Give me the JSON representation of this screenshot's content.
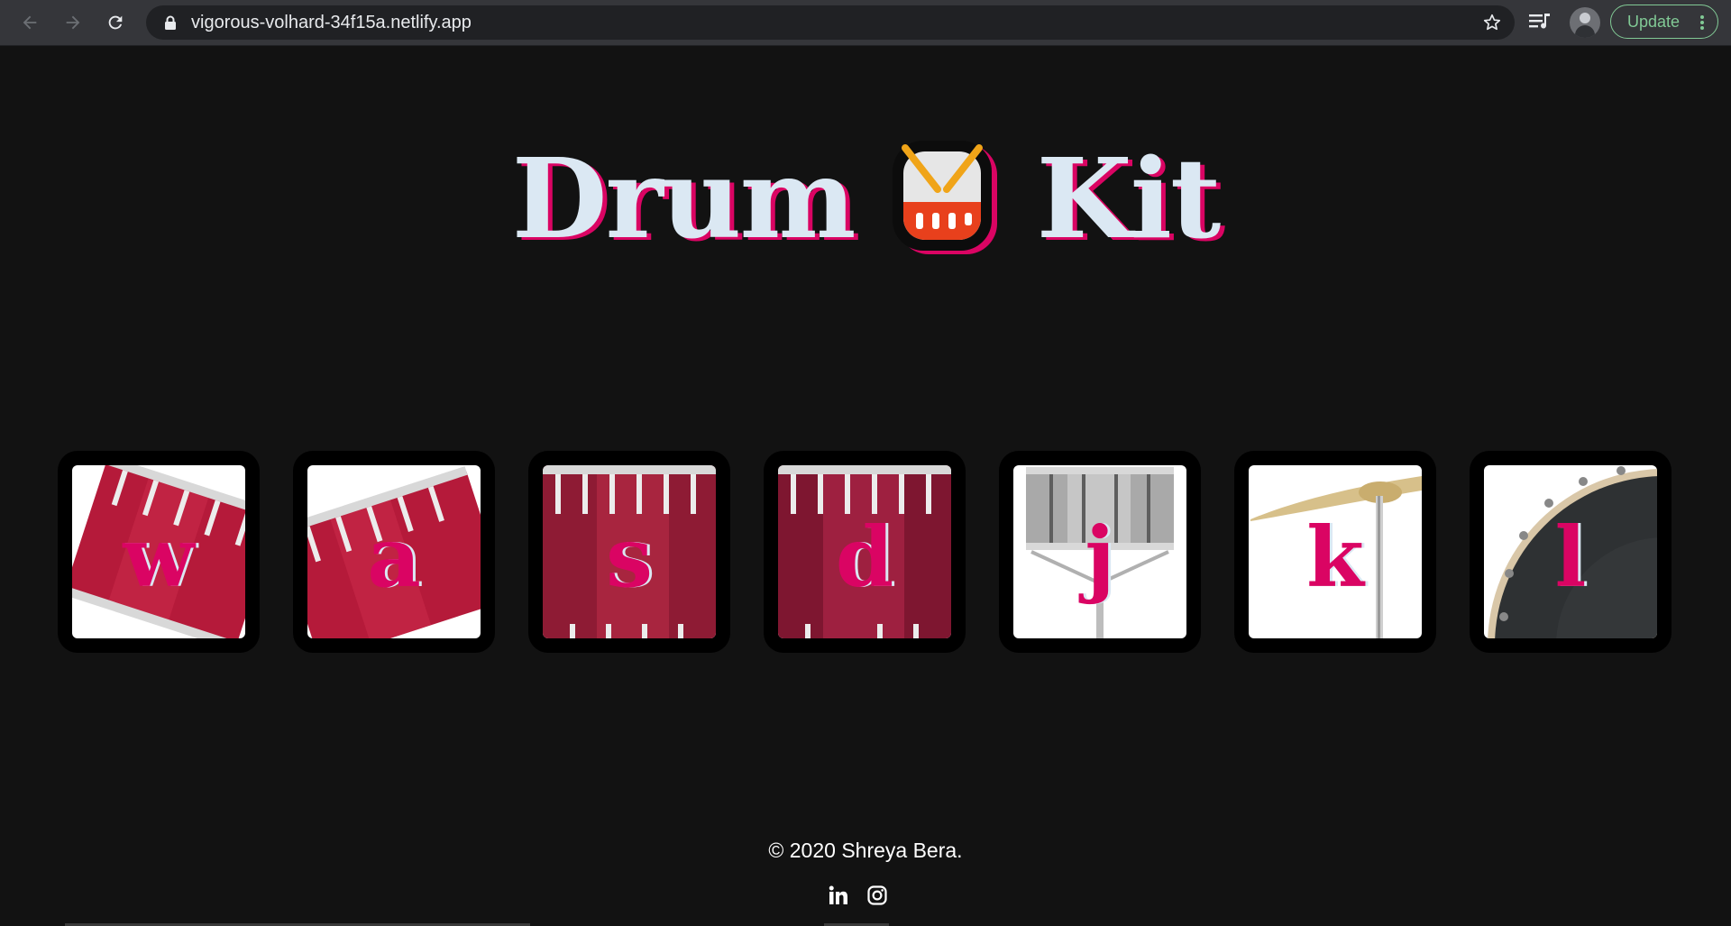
{
  "browser": {
    "url": "vigorous-volhard-34f15a.netlify.app",
    "update_label": "Update",
    "icons": [
      "back-arrow-icon",
      "forward-arrow-icon",
      "reload-icon",
      "lock-icon",
      "bookmark-star-icon",
      "media-queue-icon",
      "profile-avatar",
      "kebab-menu-icon"
    ]
  },
  "page": {
    "title_left": "Drum",
    "title_right": "Kit",
    "logo_icon": "drum-emoji-icon",
    "accent_color": "#da0463",
    "title_color": "#dbe8f3",
    "background_color": "#121212"
  },
  "keys": [
    {
      "letter": "w",
      "image": "tom-drum-tilted"
    },
    {
      "letter": "a",
      "image": "tom-drum-tilted"
    },
    {
      "letter": "s",
      "image": "bass-drum-side"
    },
    {
      "letter": "d",
      "image": "bass-drum-side"
    },
    {
      "letter": "j",
      "image": "snare-drum"
    },
    {
      "letter": "k",
      "image": "crash-cymbal"
    },
    {
      "letter": "l",
      "image": "kick-drum-head"
    }
  ],
  "footer": {
    "copyright": "© 2020 Shreya Bera.",
    "social_icons": [
      "linkedin-icon",
      "instagram-icon"
    ]
  }
}
